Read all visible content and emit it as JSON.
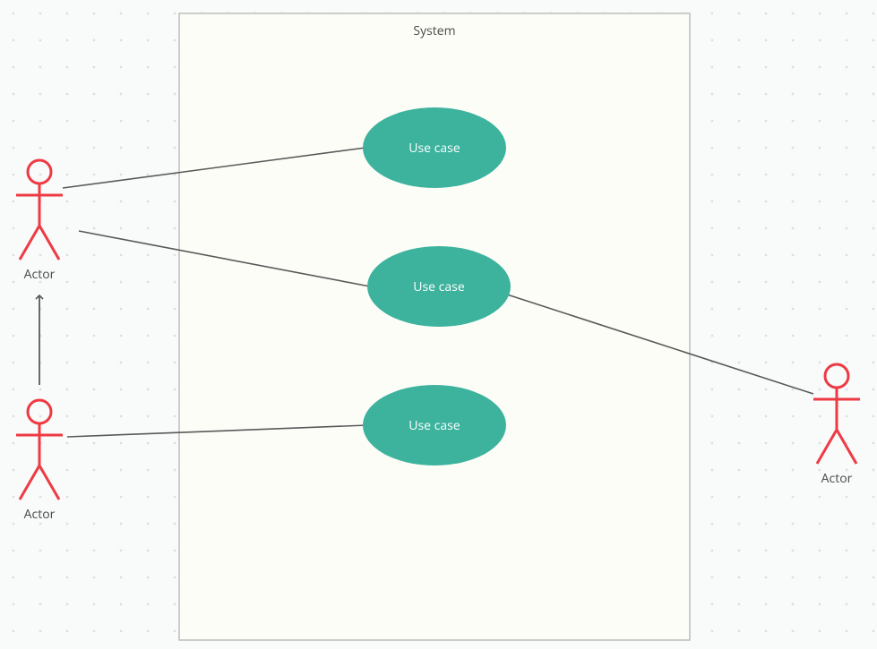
{
  "system": {
    "label": "System"
  },
  "actors": {
    "top_left": {
      "label": "Actor"
    },
    "bottom_left": {
      "label": "Actor"
    },
    "right": {
      "label": "Actor"
    }
  },
  "use_cases": {
    "uc1": {
      "label": "Use case"
    },
    "uc2": {
      "label": "Use case"
    },
    "uc3": {
      "label": "Use case"
    }
  },
  "colors": {
    "actor_stroke": "#ee3a43",
    "usecase_fill": "#3db39e",
    "system_border": "#bdbdbd",
    "connector": "#595959",
    "canvas_bg": "#f9fafa",
    "dot": "#dcdfe3"
  }
}
